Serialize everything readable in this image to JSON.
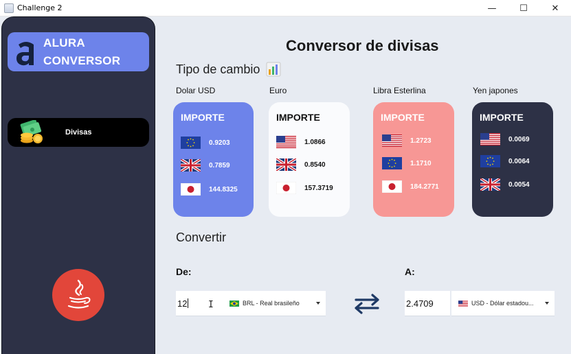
{
  "window": {
    "title": "Challenge 2",
    "minimize": "—",
    "maximize": "☐",
    "close": "✕"
  },
  "sidebar": {
    "logo_line1": "ALURA",
    "logo_line2": "CONVERSOR",
    "nav_item": "Divisas"
  },
  "main": {
    "title": "Conversor de divisas",
    "section_rates": "Tipo de cambio",
    "section_convert": "Convertir"
  },
  "cards": [
    {
      "label": "Dolar USD",
      "heading": "IMPORTE",
      "rates": [
        {
          "flag": "eu-flag",
          "value": "0.9203"
        },
        {
          "flag": "uk-flag",
          "value": "0.7859"
        },
        {
          "flag": "jp-flag",
          "value": "144.8325"
        }
      ]
    },
    {
      "label": "Euro",
      "heading": "IMPORTE",
      "rates": [
        {
          "flag": "us-flag",
          "value": "1.0866"
        },
        {
          "flag": "uk-flag",
          "value": "0.8540"
        },
        {
          "flag": "jp-flag",
          "value": "157.3719"
        }
      ]
    },
    {
      "label": "Libra Esterlina",
      "heading": "IMPORTE",
      "rates": [
        {
          "flag": "us-flag",
          "value": "1.2723"
        },
        {
          "flag": "eu-flag",
          "value": "1.1710"
        },
        {
          "flag": "jp-flag",
          "value": "184.2771"
        }
      ]
    },
    {
      "label": "Yen japones",
      "heading": "IMPORTE",
      "rates": [
        {
          "flag": "us-flag",
          "value": "0.0069"
        },
        {
          "flag": "eu-flag",
          "value": "0.0064"
        },
        {
          "flag": "uk-flag",
          "value": "0.0054"
        }
      ]
    }
  ],
  "converter": {
    "from_label": "De:",
    "to_label": "A:",
    "from_amount": "12",
    "from_currency": "BRL - Real brasileño",
    "to_amount": "2.4709",
    "to_currency": "USD - Dólar estadou..."
  },
  "colors": {
    "sidebar_bg": "#2d3146",
    "accent_blue": "#6d83ea",
    "card_pink": "#f79795",
    "java_red": "#e2463a",
    "swap_arrows": "#1f3a66"
  }
}
